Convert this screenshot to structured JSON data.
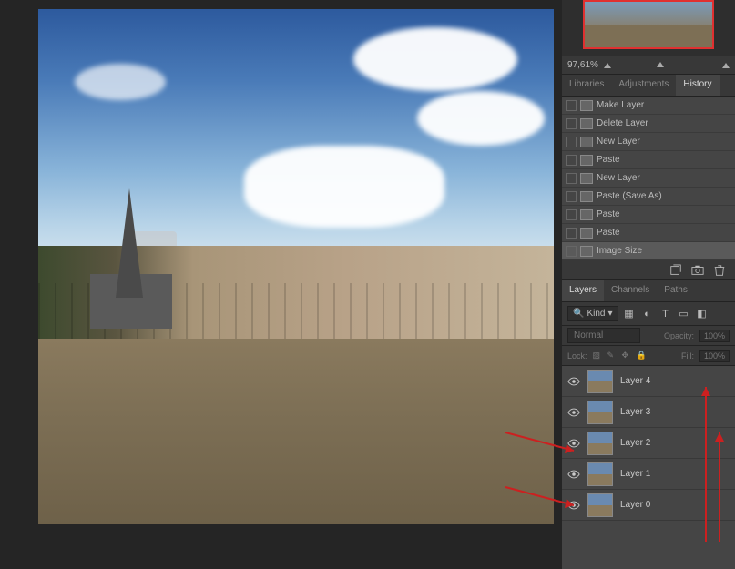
{
  "zoom": {
    "value": "97,61%"
  },
  "panel1_tabs": [
    {
      "label": "Libraries",
      "active": false
    },
    {
      "label": "Adjustments",
      "active": false
    },
    {
      "label": "History",
      "active": true
    }
  ],
  "history": [
    {
      "label": "Make Layer"
    },
    {
      "label": "Delete Layer"
    },
    {
      "label": "New Layer"
    },
    {
      "label": "Paste"
    },
    {
      "label": "New Layer"
    },
    {
      "label": "Paste (Save As)"
    },
    {
      "label": "Paste"
    },
    {
      "label": "Paste"
    },
    {
      "label": "Image Size"
    }
  ],
  "panel2_tabs": [
    {
      "label": "Layers",
      "active": true
    },
    {
      "label": "Channels",
      "active": false
    },
    {
      "label": "Paths",
      "active": false
    }
  ],
  "layer_filter": {
    "kind": "Kind"
  },
  "blend": {
    "mode": "Normal",
    "opacity_label": "Opacity:",
    "opacity_value": "100%"
  },
  "lock": {
    "label": "Lock:",
    "fill_label": "Fill:",
    "fill_value": "100%"
  },
  "layers": [
    {
      "name": "Layer 4"
    },
    {
      "name": "Layer 3"
    },
    {
      "name": "Layer 2"
    },
    {
      "name": "Layer 1"
    },
    {
      "name": "Layer 0"
    }
  ]
}
